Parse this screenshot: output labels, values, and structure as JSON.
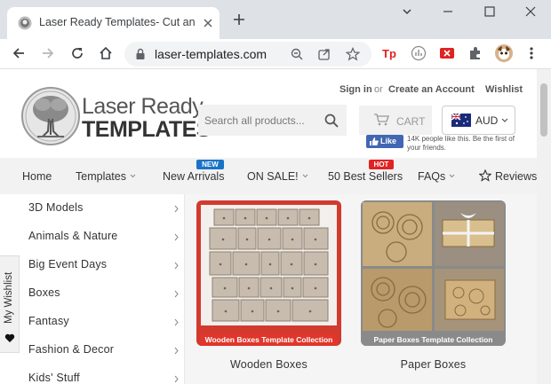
{
  "browser": {
    "tab_title": "Laser Ready Templates- Cut and Engrave",
    "url": "laser-templates.com"
  },
  "header": {
    "logo_line1": "Laser Ready",
    "logo_line2": "TEMPLATES",
    "search_placeholder": "Search all products...",
    "sign_in": "Sign in",
    "or": "or",
    "create_account": "Create an Account",
    "wishlist": "Wishlist",
    "cart_label": "CART",
    "currency": "AUD",
    "fb_like": "Like",
    "fb_text": "14K people like this. Be the first of your friends."
  },
  "nav": {
    "items": [
      {
        "label": "Home"
      },
      {
        "label": "Templates"
      },
      {
        "label": "New Arrivals",
        "badge": "NEW"
      },
      {
        "label": "ON SALE!"
      },
      {
        "label": "50 Best Sellers",
        "badge": "HOT"
      },
      {
        "label": "FAQs"
      },
      {
        "label": "Reviews"
      }
    ]
  },
  "sidebar": {
    "wishlist_tab": "My Wishlist",
    "categories": [
      {
        "label": "3D Models"
      },
      {
        "label": "Animals & Nature"
      },
      {
        "label": "Big Event Days"
      },
      {
        "label": "Boxes"
      },
      {
        "label": "Fantasy"
      },
      {
        "label": "Fashion & Decor"
      },
      {
        "label": "Kids' Stuff"
      }
    ]
  },
  "products": [
    {
      "name": "Wooden Boxes",
      "caption": "Wooden Boxes Template Collection"
    },
    {
      "name": "Paper Boxes",
      "caption": "Paper Boxes Template Collection"
    }
  ],
  "colors": {
    "new_badge": "#1a73c6",
    "hot_badge": "#e02222",
    "wooden_caption": "#e0362b",
    "paper_caption": "#8a8a8a",
    "fb_blue": "#4267b2"
  }
}
